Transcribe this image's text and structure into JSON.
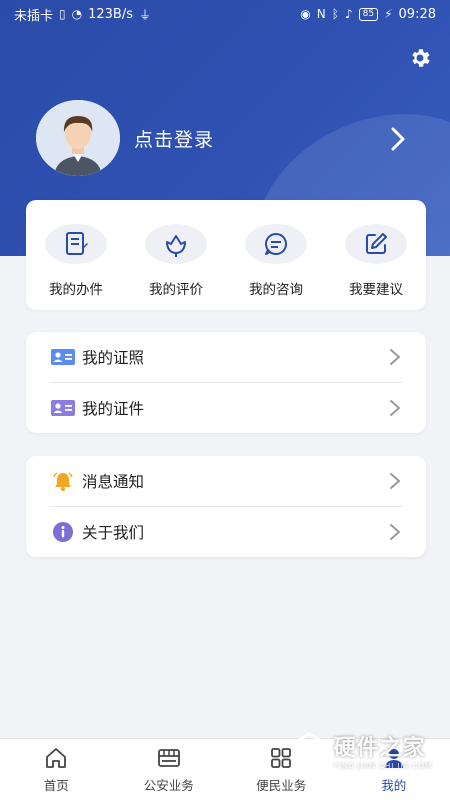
{
  "status_bar": {
    "carrier": "未插卡",
    "speed": "123B/s",
    "battery": "85",
    "time": "09:28"
  },
  "profile": {
    "login_text": "点击登录"
  },
  "quick_actions": [
    {
      "label": "我的办件",
      "icon": "document-edit-icon"
    },
    {
      "label": "我的评价",
      "icon": "lotus-icon"
    },
    {
      "label": "我的咨询",
      "icon": "chat-bubble-icon"
    },
    {
      "label": "我要建议",
      "icon": "pencil-square-icon"
    }
  ],
  "list_group_1": [
    {
      "label": "我的证照",
      "icon": "id-card-icon"
    },
    {
      "label": "我的证件",
      "icon": "id-card-purple-icon"
    }
  ],
  "list_group_2": [
    {
      "label": "消息通知",
      "icon": "bell-icon"
    },
    {
      "label": "关于我们",
      "icon": "info-icon"
    }
  ],
  "tabs": [
    {
      "label": "首页",
      "icon": "home-icon"
    },
    {
      "label": "公安业务",
      "icon": "store-icon"
    },
    {
      "label": "便民业务",
      "icon": "grid-icon"
    },
    {
      "label": "我的",
      "icon": "person-icon",
      "active": true
    }
  ],
  "watermark": {
    "text": "硬件之家",
    "sub": "YING JIAN ZHI JIA.COM"
  },
  "colors": {
    "primary": "#2b4ba8",
    "background": "#f2f3f7",
    "bell": "#f5a623",
    "info": "#7b6fd6",
    "card_icon_blue": "#5b8def",
    "card_icon_purple": "#8b7ce0"
  }
}
